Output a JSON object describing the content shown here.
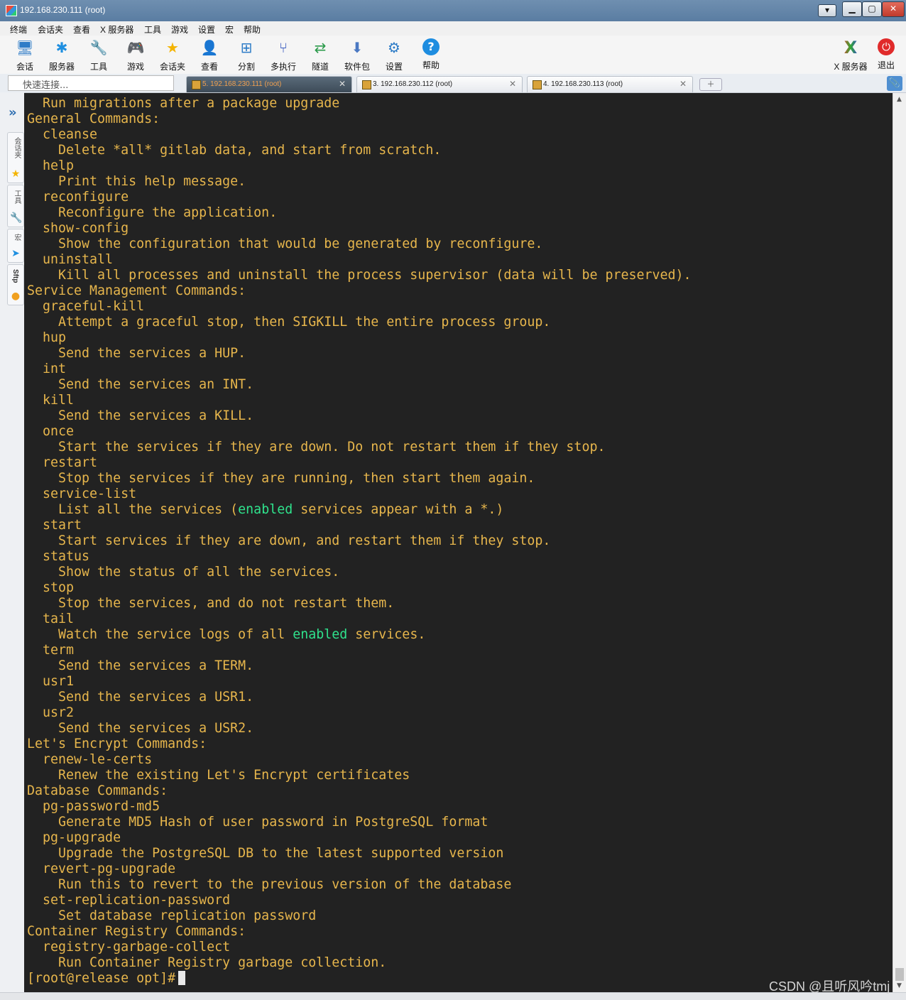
{
  "window": {
    "title": "192.168.230.111 (root)"
  },
  "menu": [
    "终端",
    "会话夹",
    "查看",
    "X 服务器",
    "工具",
    "游戏",
    "设置",
    "宏",
    "帮助"
  ],
  "toolbar": {
    "left": [
      {
        "label": "会话",
        "icon": "session-monitor-icon"
      },
      {
        "label": "服务器",
        "icon": "servers-icon"
      },
      {
        "label": "工具",
        "icon": "tools-icon"
      },
      {
        "label": "游戏",
        "icon": "games-icon"
      },
      {
        "label": "会话夹",
        "icon": "star-icon"
      },
      {
        "label": "查看",
        "icon": "view-icon"
      },
      {
        "label": "分割",
        "icon": "split-icon"
      },
      {
        "label": "多执行",
        "icon": "multiexec-icon"
      },
      {
        "label": "隧道",
        "icon": "tunnel-icon"
      },
      {
        "label": "软件包",
        "icon": "packages-icon"
      },
      {
        "label": "设置",
        "icon": "settings-gear-icon"
      },
      {
        "label": "帮助",
        "icon": "help-icon"
      }
    ],
    "right": [
      {
        "label": "X 服务器",
        "icon": "x-server-icon"
      },
      {
        "label": "退出",
        "icon": "power-icon"
      }
    ]
  },
  "quick_connect": {
    "placeholder": "快速连接..."
  },
  "tabs": [
    {
      "label": "5. 192.168.230.111 (root)",
      "active": true
    },
    {
      "label": "3. 192.168.230.112 (root)",
      "active": false
    },
    {
      "label": "4. 192.168.230.113 (root)",
      "active": false
    }
  ],
  "sidebar": {
    "tabs": [
      "会话夹",
      "工具",
      "宏",
      "Sftp"
    ]
  },
  "terminal": {
    "lines": [
      {
        "text": "  Run migrations after a package upgrade"
      },
      {
        "text": "General Commands:"
      },
      {
        "text": "  cleanse"
      },
      {
        "text": "    Delete *all* gitlab data, and start from scratch."
      },
      {
        "text": "  help"
      },
      {
        "text": "    Print this help message."
      },
      {
        "text": "  reconfigure"
      },
      {
        "text": "    Reconfigure the application."
      },
      {
        "text": "  show-config"
      },
      {
        "text": "    Show the configuration that would be generated by reconfigure."
      },
      {
        "text": "  uninstall"
      },
      {
        "text": "    Kill all processes and uninstall the process supervisor (data will be preserved)."
      },
      {
        "text": "Service Management Commands:"
      },
      {
        "text": "  graceful-kill"
      },
      {
        "text": "    Attempt a graceful stop, then SIGKILL the entire process group."
      },
      {
        "text": "  hup"
      },
      {
        "text": "    Send the services a HUP."
      },
      {
        "text": "  int"
      },
      {
        "text": "    Send the services an INT."
      },
      {
        "text": "  kill"
      },
      {
        "text": "    Send the services a KILL."
      },
      {
        "text": "  once"
      },
      {
        "text": "    Start the services if they are down. Do not restart them if they stop."
      },
      {
        "text": "  restart"
      },
      {
        "text": "    Stop the services if they are running, then start them again."
      },
      {
        "text": "  service-list"
      },
      {
        "parts": [
          {
            "text": "    List all the services ("
          },
          {
            "text": "enabled",
            "hl": true
          },
          {
            "text": " services appear with a *.)"
          }
        ]
      },
      {
        "text": "  start"
      },
      {
        "text": "    Start services if they are down, and restart them if they stop."
      },
      {
        "text": "  status"
      },
      {
        "text": "    Show the status of all the services."
      },
      {
        "text": "  stop"
      },
      {
        "text": "    Stop the services, and do not restart them."
      },
      {
        "text": "  tail"
      },
      {
        "parts": [
          {
            "text": "    Watch the service logs of all "
          },
          {
            "text": "enabled",
            "hl": true
          },
          {
            "text": " services."
          }
        ]
      },
      {
        "text": "  term"
      },
      {
        "text": "    Send the services a TERM."
      },
      {
        "text": "  usr1"
      },
      {
        "text": "    Send the services a USR1."
      },
      {
        "text": "  usr2"
      },
      {
        "text": "    Send the services a USR2."
      },
      {
        "text": "Let's Encrypt Commands:"
      },
      {
        "text": "  renew-le-certs"
      },
      {
        "text": "    Renew the existing Let's Encrypt certificates"
      },
      {
        "text": "Database Commands:"
      },
      {
        "text": "  pg-password-md5"
      },
      {
        "text": "    Generate MD5 Hash of user password in PostgreSQL format"
      },
      {
        "text": "  pg-upgrade"
      },
      {
        "text": "    Upgrade the PostgreSQL DB to the latest supported version"
      },
      {
        "text": "  revert-pg-upgrade"
      },
      {
        "text": "    Run this to revert to the previous version of the database"
      },
      {
        "text": "  set-replication-password"
      },
      {
        "text": "    Set database replication password"
      },
      {
        "text": "Container Registry Commands:"
      },
      {
        "text": "  registry-garbage-collect"
      },
      {
        "text": "    Run Container Registry garbage collection."
      }
    ],
    "prompt": "[root@release opt]#"
  },
  "watermark": "CSDN @且听风吟tmj",
  "colors": {
    "terminal_bg": "#222222",
    "terminal_text": "#e7b64c",
    "highlight": "#2fe28c"
  }
}
